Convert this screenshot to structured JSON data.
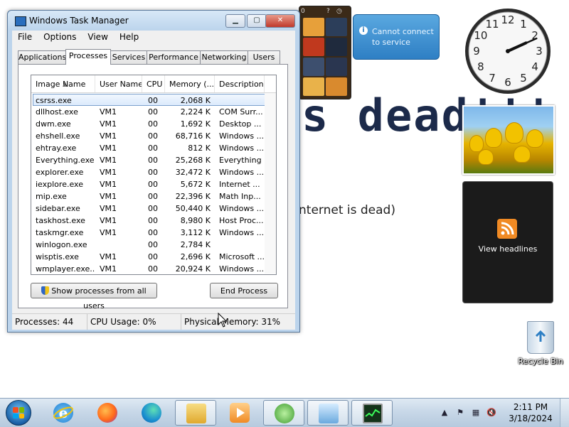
{
  "desktop": {
    "wallpaper_big": "s dead!!!",
    "wallpaper_small": "nternet is dead)",
    "weather_text": "Cannot connect to service",
    "feed_text": "View headlines",
    "recycle_bin": "Recycle Bin",
    "clock": {
      "hour": 2,
      "minute": 11
    }
  },
  "window": {
    "title": "Windows Task Manager",
    "menus": [
      "File",
      "Options",
      "View",
      "Help"
    ],
    "tabs": [
      "Applications",
      "Processes",
      "Services",
      "Performance",
      "Networking",
      "Users"
    ],
    "active_tab": "Processes",
    "columns": [
      "Image Name",
      "User Name",
      "CPU",
      "Memory (...",
      "Description"
    ],
    "processes": [
      {
        "name": "csrss.exe",
        "user": "",
        "cpu": "00",
        "mem": "2,068 K",
        "desc": ""
      },
      {
        "name": "dllhost.exe",
        "user": "VM1",
        "cpu": "00",
        "mem": "2,224 K",
        "desc": "COM Surr..."
      },
      {
        "name": "dwm.exe",
        "user": "VM1",
        "cpu": "00",
        "mem": "1,692 K",
        "desc": "Desktop ..."
      },
      {
        "name": "ehshell.exe",
        "user": "VM1",
        "cpu": "00",
        "mem": "68,716 K",
        "desc": "Windows ..."
      },
      {
        "name": "ehtray.exe",
        "user": "VM1",
        "cpu": "00",
        "mem": "812 K",
        "desc": "Windows ..."
      },
      {
        "name": "Everything.exe",
        "user": "VM1",
        "cpu": "00",
        "mem": "25,268 K",
        "desc": "Everything"
      },
      {
        "name": "explorer.exe",
        "user": "VM1",
        "cpu": "00",
        "mem": "32,472 K",
        "desc": "Windows ..."
      },
      {
        "name": "iexplore.exe",
        "user": "VM1",
        "cpu": "00",
        "mem": "5,672 K",
        "desc": "Internet ..."
      },
      {
        "name": "mip.exe",
        "user": "VM1",
        "cpu": "00",
        "mem": "22,396 K",
        "desc": "Math Inp..."
      },
      {
        "name": "sidebar.exe",
        "user": "VM1",
        "cpu": "00",
        "mem": "50,440 K",
        "desc": "Windows ..."
      },
      {
        "name": "taskhost.exe",
        "user": "VM1",
        "cpu": "00",
        "mem": "8,980 K",
        "desc": "Host Proc..."
      },
      {
        "name": "taskmgr.exe",
        "user": "VM1",
        "cpu": "00",
        "mem": "3,112 K",
        "desc": "Windows ..."
      },
      {
        "name": "winlogon.exe",
        "user": "",
        "cpu": "00",
        "mem": "2,784 K",
        "desc": ""
      },
      {
        "name": "wisptis.exe",
        "user": "VM1",
        "cpu": "00",
        "mem": "2,696 K",
        "desc": "Microsoft ..."
      },
      {
        "name": "wmplayer.exe...",
        "user": "VM1",
        "cpu": "00",
        "mem": "20,924 K",
        "desc": "Windows ..."
      }
    ],
    "show_all_label": "Show processes from all users",
    "end_process_label": "End Process",
    "status": {
      "processes": "Processes: 44",
      "cpu": "CPU Usage: 0%",
      "memory": "Physical Memory: 31%"
    }
  },
  "taskbar": {
    "time": "2:11 PM",
    "date": "3/18/2024",
    "pinned_icons": [
      "internet-explorer-icon",
      "firefox-icon",
      "edge-icon",
      "windows-explorer-icon",
      "media-player-icon",
      "windows-update-icon",
      "control-panel-icon",
      "task-manager-icon"
    ]
  },
  "colors": {
    "selection": "#dbeafc",
    "title_bar": "#bcd4ec",
    "taskbar": "#c8d8e8"
  }
}
